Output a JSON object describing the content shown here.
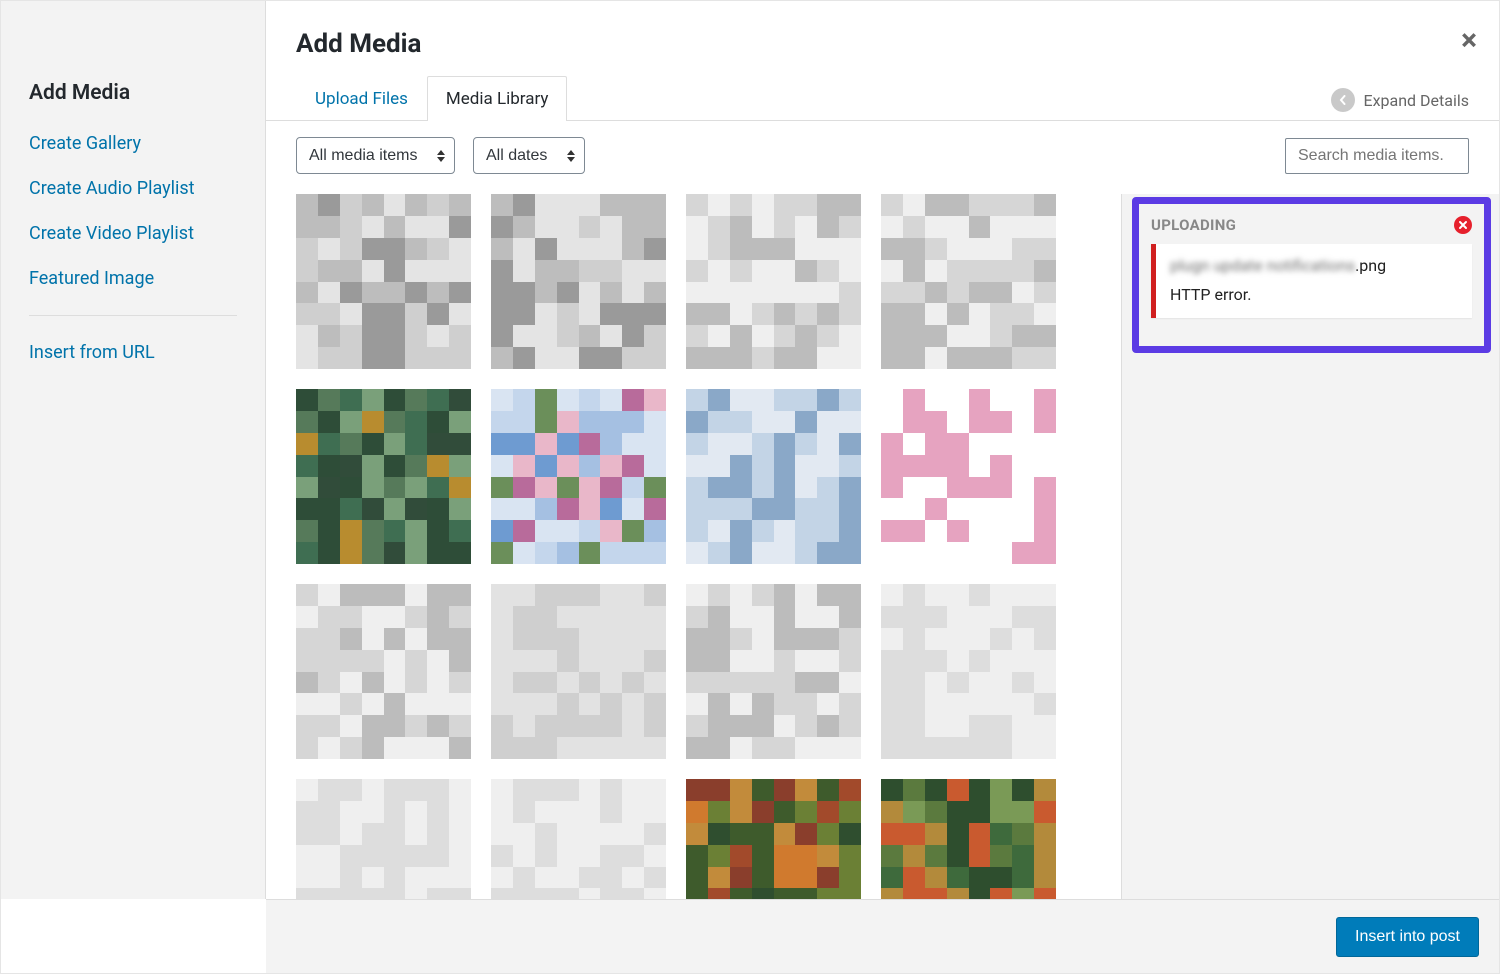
{
  "sidebar": {
    "title": "Add Media",
    "items": [
      "Create Gallery",
      "Create Audio Playlist",
      "Create Video Playlist",
      "Featured Image"
    ],
    "insert_url": "Insert from URL"
  },
  "header": {
    "title": "Add Media",
    "expand": "Expand Details"
  },
  "tabs": {
    "upload": "Upload Files",
    "library": "Media Library"
  },
  "toolbar": {
    "filter_type": "All media items",
    "filter_date": "All dates",
    "search_placeholder": "Search media items."
  },
  "uploading": {
    "label": "UPLOADING",
    "file_suffix": ".png",
    "error": "HTTP error."
  },
  "footer": {
    "insert": "Insert into post"
  }
}
